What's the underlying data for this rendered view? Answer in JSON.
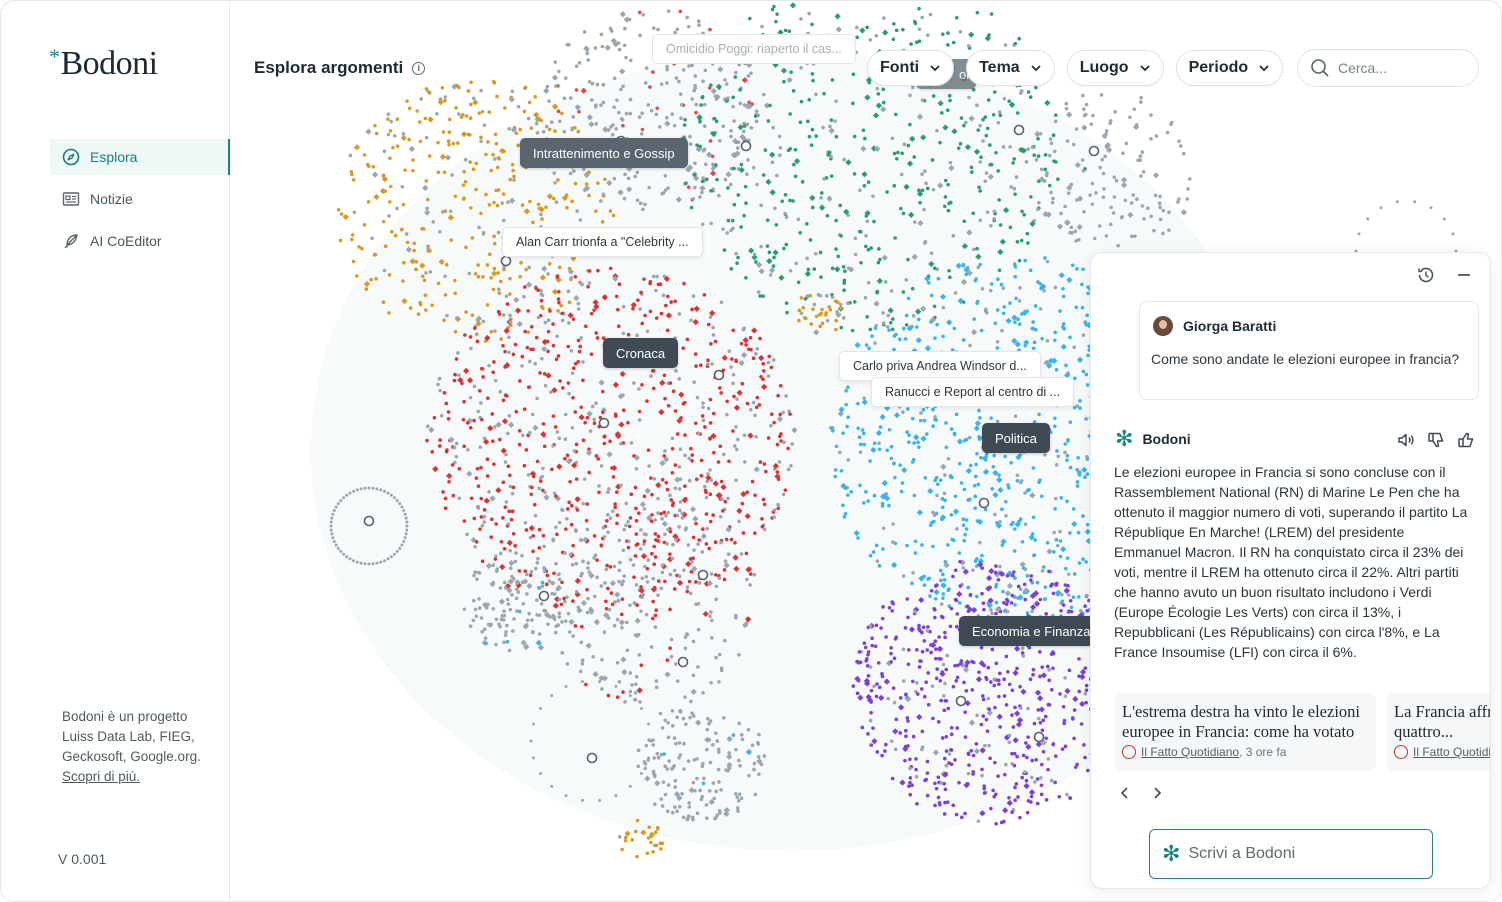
{
  "brand": {
    "name": "Bodoni",
    "star": "*"
  },
  "nav": [
    {
      "label": "Esplora",
      "icon": "compass-icon",
      "active": true
    },
    {
      "label": "Notizie",
      "icon": "newspaper-icon",
      "active": false
    },
    {
      "label": "AI CoEditor",
      "icon": "feather-icon",
      "active": false
    }
  ],
  "about": {
    "text": "Bodoni è un progetto Luiss Data Lab, FIEG, Geckosoft, Google.org.",
    "link": "Scopri di più."
  },
  "version": "V 0.001",
  "header": {
    "title": "Esplora argomenti",
    "info": "i"
  },
  "filters": [
    "Fonti",
    "Tema",
    "Luogo",
    "Periodo"
  ],
  "search": {
    "placeholder": "Cerca..."
  },
  "graph_labels": {
    "dark": [
      "Intrattenimento e Gossip",
      "Cronaca",
      "Politica",
      "Economia e Finanza"
    ],
    "light": [
      "Omicidio Poggi: riaperto il cas...",
      "Alan Carr trionfa a \"Celebrity ...",
      "Carlo priva Andrea Windsor d...",
      "Ranucci e Report al centro di ..."
    ],
    "hidden": "ort"
  },
  "colors": {
    "gossip": "#d99a1f",
    "cronaca": "#e0302f",
    "politica": "#39b3e8",
    "economia": "#7b3fe0",
    "sport": "#2a9d6f",
    "other": "#9aa6b0",
    "accent": "#16877f"
  },
  "chat": {
    "user": {
      "name": "Giorga Baratti",
      "message": "Come sono andate le elezioni europee in francia?"
    },
    "bot": {
      "name": "Bodoni",
      "message": "Le elezioni europee in Francia si sono concluse con il Rassemblement National (RN) di Marine Le Pen che ha ottenuto il maggior numero di voti, superando il partito La République En Marche! (LREM) del presidente Emmanuel Macron. Il RN ha conquistato circa il 23% dei voti, mentre il LREM ha ottenuto circa il 22%. Altri partiti che hanno avuto un buon risultato includono i Verdi (Europe Écologie Les Verts) con circa il 13%, i Repubblicani (Les Républicains) con circa l'8%, e La France Insoumise (LFI) con circa il 6%."
    },
    "cards": [
      {
        "title": "L'estrema destra ha vinto le elezioni europee in Francia: come ha votato l...",
        "source": "Il Fatto Quotidiano",
        "time": ", 3 ore fa"
      },
      {
        "title": "La Francia affronta politica: quattro...",
        "source": "Il Fatto Quotidiano",
        "time": ""
      }
    ],
    "compose_placeholder": "Scrivi a Bodoni"
  }
}
